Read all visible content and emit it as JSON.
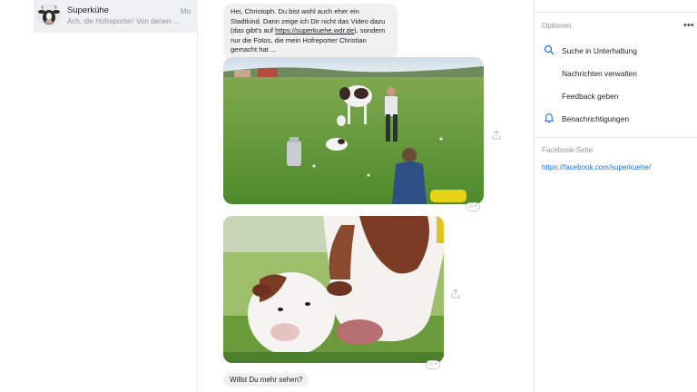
{
  "conversation": {
    "name": "Superkühe",
    "time": "Mo",
    "preview": "Ach, die Hofreporter! Von denen hab..."
  },
  "chat": {
    "message1": {
      "text_before": "Hei, Christoph. Du bist wohl auch eher ein Stadtkind. Dann zeige ich Dir nicht das Video dazu (das gibt's auf ",
      "link": "https://superkuehe.wdr.de",
      "text_after": "), sondern nur die Fotos, die mein Hofreporter Christian gemacht hat ..."
    },
    "message_last": "Willst Du mehr sehen?"
  },
  "details": {
    "options_title": "Optionen",
    "options": [
      {
        "label": "Suche in Unterhaltung",
        "icon": "search-icon"
      },
      {
        "label": "Nachrichten verwalten",
        "icon": ""
      },
      {
        "label": "Feedback geben",
        "icon": ""
      },
      {
        "label": "Benachrichtigungen",
        "icon": "bell-icon"
      }
    ],
    "facebook_title": "Facebook-Seite",
    "facebook_link": "https://facebook.com/superkuehe/"
  },
  "colors": {
    "accent": "#1a73d9",
    "bubble": "#f1f0f0"
  }
}
